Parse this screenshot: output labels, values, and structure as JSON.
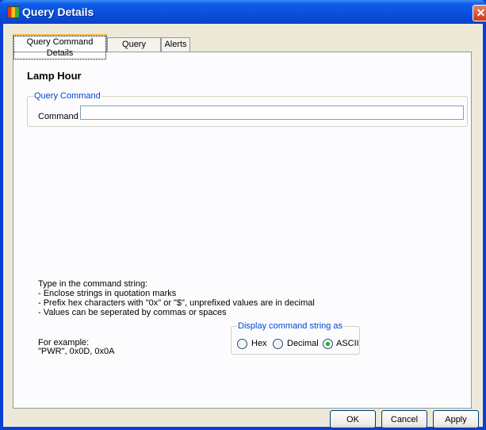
{
  "window": {
    "title": "Query Details",
    "close_glyph": "✕"
  },
  "tabs": [
    {
      "label": "Query Command Details",
      "active": true
    },
    {
      "label": "Query Format",
      "active": false
    },
    {
      "label": "Alerts",
      "active": false
    }
  ],
  "heading": "Lamp Hour",
  "query_command": {
    "legend": "Query Command",
    "command_label": "Command",
    "command_value": ""
  },
  "help": {
    "lines": [
      "Type in the command string:",
      "- Enclose strings in quotation marks",
      "- Prefix hex characters with \"0x\" or \"$\", unprefixed values are in decimal",
      "- Values can be seperated by commas or spaces"
    ],
    "example_label": "For example:",
    "example_value": "\"PWR\", 0x0D, 0x0A"
  },
  "display_as": {
    "legend": "Display command string as",
    "options": [
      {
        "label": "Hex",
        "selected": false
      },
      {
        "label": "Decimal",
        "selected": false
      },
      {
        "label": "ASCII",
        "selected": true
      }
    ]
  },
  "buttons": {
    "ok": "OK",
    "cancel": "Cancel",
    "apply": "Apply"
  },
  "colors": {
    "titlebar": "#0a4fdc",
    "legend_text": "#0046d5",
    "radio_selected": "#21a121"
  }
}
